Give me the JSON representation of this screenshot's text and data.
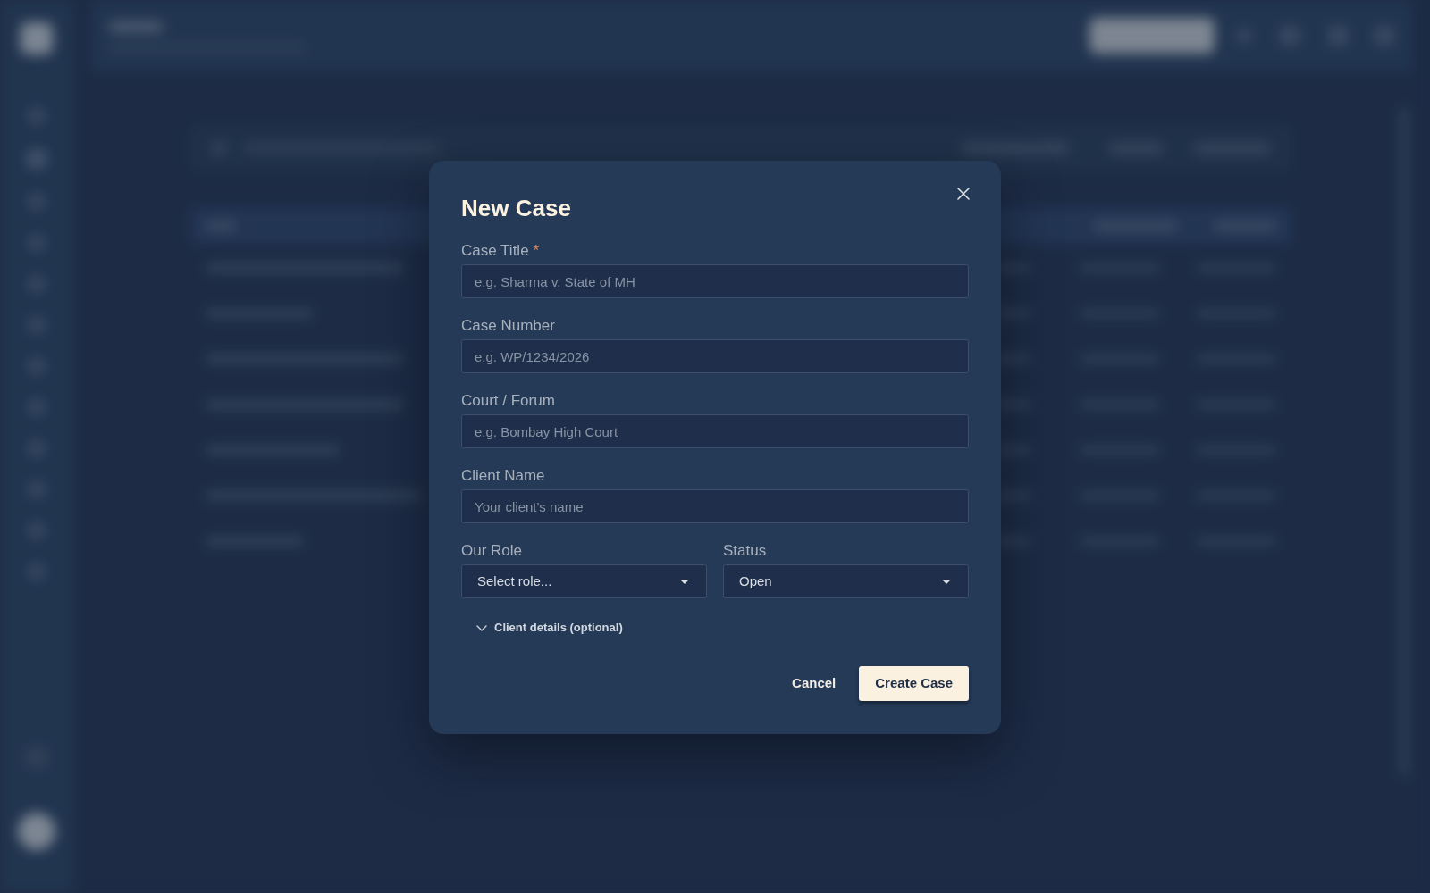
{
  "dialog": {
    "title": "New Case",
    "fields": [
      {
        "label": "Case Title",
        "required_mark": "*",
        "placeholder": "e.g. Sharma v. State of MH"
      },
      {
        "label": "Case Number",
        "placeholder": "e.g. WP/1234/2026"
      },
      {
        "label": "Court / Forum",
        "placeholder": "e.g. Bombay High Court"
      },
      {
        "label": "Client Name",
        "placeholder": "Your client's name"
      }
    ],
    "selects": [
      {
        "label": "Our Role",
        "value": "Select role..."
      },
      {
        "label": "Status",
        "value": "Open"
      }
    ],
    "section": {
      "label": "Client details (optional)",
      "expanded": false
    },
    "actions": [
      {
        "kind": "secondary",
        "label": "Cancel"
      },
      {
        "kind": "primary",
        "label": "Create Case"
      }
    ]
  }
}
